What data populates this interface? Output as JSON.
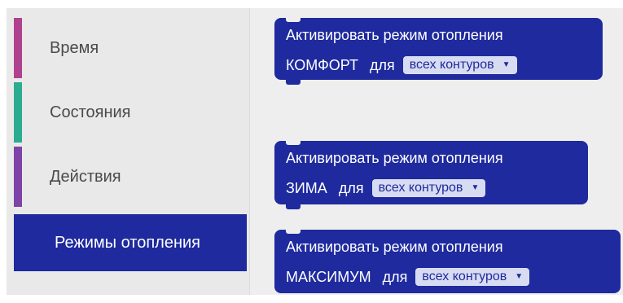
{
  "categories": [
    {
      "label": "Время",
      "color": "#b0418e"
    },
    {
      "label": "Состояния",
      "color": "#2bab8f"
    },
    {
      "label": "Действия",
      "color": "#7d43a8"
    },
    {
      "label": "Режимы отопления",
      "color": "#1e2a9e",
      "selected": true
    }
  ],
  "blocks": [
    {
      "title": "Активировать режим отопления",
      "mode": "КОМФОРТ",
      "for": "для",
      "dropdown": "всех контуров"
    },
    {
      "title": "Активировать режим отопления",
      "mode": "ЗИМА",
      "for": "для",
      "dropdown": "всех контуров"
    },
    {
      "title": "Активировать режим отопления",
      "mode": "МАКСИМУМ",
      "for": "для",
      "dropdown": "всех контуров"
    }
  ],
  "icons": {
    "dropdown_arrow": "▼"
  }
}
